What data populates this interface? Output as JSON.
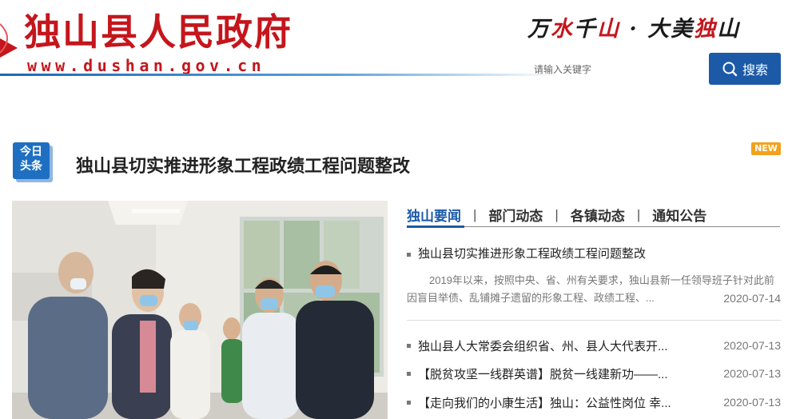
{
  "header": {
    "site_title": "独山县人民政府",
    "site_url": "www.dushan.gov.cn",
    "slogan_part1_a": "万",
    "slogan_part1_b": "水",
    "slogan_part1_c": "千",
    "slogan_part1_d": "山",
    "slogan_dot": "·",
    "slogan_part2_a": "大美",
    "slogan_part2_b": "独",
    "slogan_part2_c": "山",
    "search_placeholder": "请输入关键字",
    "search_button": "搜索"
  },
  "headline": {
    "badge_line1": "今日",
    "badge_line2": "头条",
    "title": "独山县切实推进形象工程政绩工程问题整改",
    "new_label": "NEW"
  },
  "tabs": [
    {
      "label": "独山要闻",
      "active": true
    },
    {
      "label": "部门动态",
      "active": false
    },
    {
      "label": "各镇动态",
      "active": false
    },
    {
      "label": "通知公告",
      "active": false
    }
  ],
  "tab_separator": "|",
  "featured_news": {
    "title": "独山县切实推进形象工程政绩工程问题整改",
    "summary": "2019年以来，按照中央、省、州有关要求，独山县新一任领导班子针对此前因盲目举债、乱铺摊子遗留的形象工程、政绩工程、...",
    "date": "2020-07-14"
  },
  "news_list": [
    {
      "title": "独山县人大常委会组织省、州、县人大代表开...",
      "date": "2020-07-13"
    },
    {
      "title": "【脱贫攻坚一线群英谱】脱贫一线建新功——...",
      "date": "2020-07-13"
    },
    {
      "title": "【走向我们的小康生活】独山：公益性岗位 幸...",
      "date": "2020-07-13"
    }
  ],
  "colors": {
    "brand_red": "#c4161c",
    "brand_blue": "#1c5aa8",
    "new_orange": "#f3a21d"
  }
}
